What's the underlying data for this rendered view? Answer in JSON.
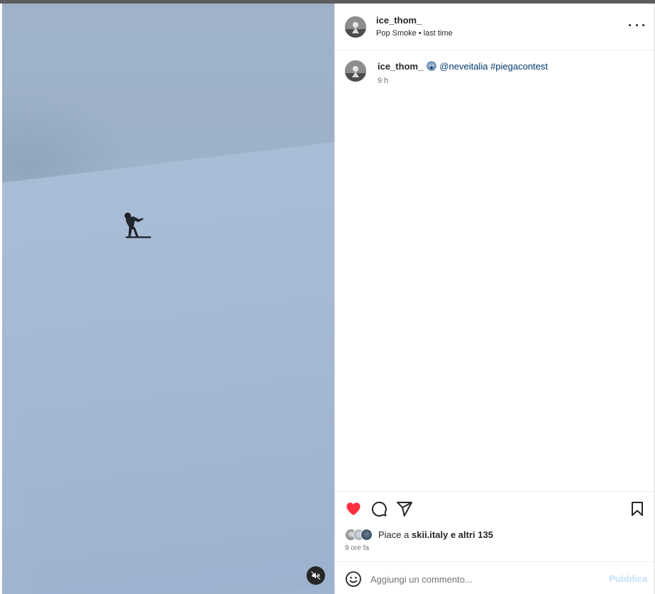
{
  "post": {
    "author": "ice_thom_",
    "audio": "Pop Smoke",
    "audio_separator": "•",
    "audio_track": "last time",
    "caption": {
      "username": "ice_thom_",
      "emoji": "astonished-face",
      "mention": "@neveitalia",
      "hashtag": "#piegacontest",
      "time": "9 h"
    },
    "likes": {
      "prefix": "Piace a",
      "user": "skii.italy",
      "suffix": "e altri 135"
    },
    "timestamp": "9 ore fa",
    "comment": {
      "placeholder": "Aggiungi un commento...",
      "publish_label": "Pubblica"
    }
  },
  "icons": {
    "media": [
      "snowboarder-video",
      "mute-icon"
    ],
    "header": [
      "avatar",
      "more-options-icon"
    ],
    "actions": [
      "heart-icon",
      "comment-icon",
      "share-icon",
      "bookmark-icon"
    ],
    "comment": [
      "emoji-icon"
    ]
  },
  "colors": {
    "like": "#ff3040",
    "link": "#00376b",
    "publish_disabled": "#c0dffd",
    "secondary_text": "#737373"
  }
}
